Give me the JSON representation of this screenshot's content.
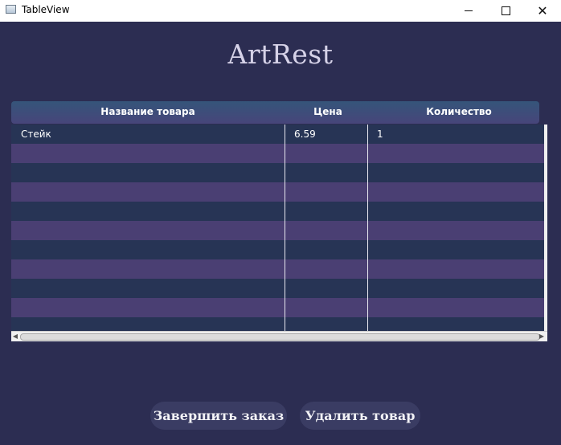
{
  "window": {
    "title": "TableView",
    "minimize_icon": "minimize-icon",
    "maximize_icon": "maximize-icon",
    "close_icon": "close-icon",
    "close_glyph": "✕"
  },
  "brand": {
    "title": "ArtRest"
  },
  "table": {
    "columns": [
      "Название товара",
      "Цена",
      "Количество"
    ],
    "rows": [
      {
        "name": "Стейк",
        "price": "6.59",
        "qty": "1"
      }
    ],
    "empty_rows": 10
  },
  "buttons": {
    "finish_label": "Завершить заказ",
    "delete_label": "Удалить товар"
  },
  "colors": {
    "background": "#2c2d52",
    "row_dark": "#273455",
    "row_purple": "#4a3f73",
    "header_top": "#35557a",
    "header_bottom": "#47457a",
    "button_bg": "#3a3c63"
  }
}
